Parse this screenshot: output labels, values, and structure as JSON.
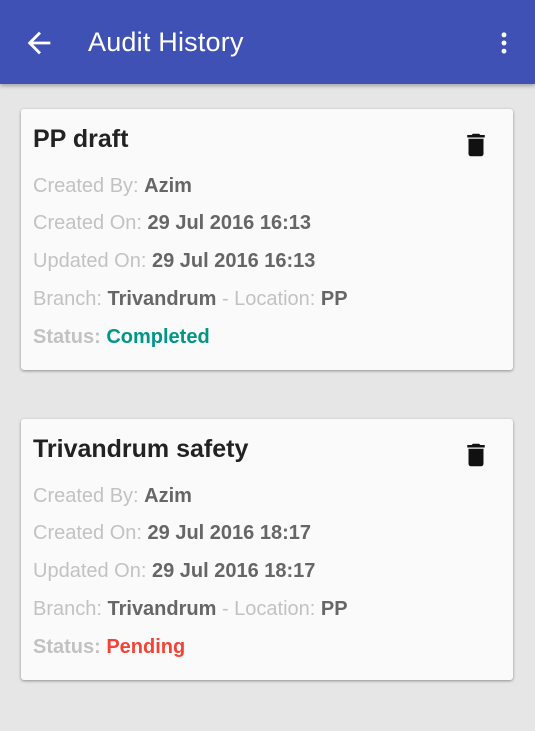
{
  "app_bar": {
    "title": "Audit History",
    "back_icon": "arrow-back-icon",
    "menu_icon": "more-vert-icon",
    "color": "#3f51b5"
  },
  "labels": {
    "created_by": "Created By: ",
    "created_on": "Created On: ",
    "updated_on": "Updated On: ",
    "branch": "Branch: ",
    "location": " - Location: ",
    "status": "Status: "
  },
  "audits": [
    {
      "title": "PP draft",
      "created_by": "Azim",
      "created_on": "29 Jul 2016 16:13",
      "updated_on": "29 Jul 2016 16:13",
      "branch": "Trivandrum",
      "location": "PP",
      "status": "Completed",
      "status_color": "#009688"
    },
    {
      "title": "Trivandrum safety",
      "created_by": "Azim",
      "created_on": "29 Jul 2016 18:17",
      "updated_on": "29 Jul 2016 18:17",
      "branch": "Trivandrum",
      "location": "PP",
      "status": "Pending",
      "status_color": "#f44336"
    }
  ]
}
